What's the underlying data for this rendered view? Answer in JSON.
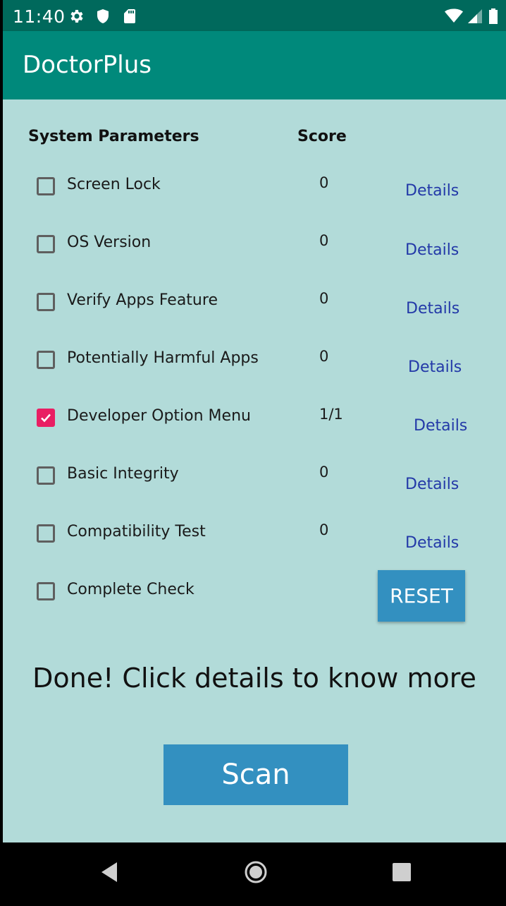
{
  "status_bar": {
    "time": "11:40",
    "icons": [
      "gear-icon",
      "shield-icon",
      "sd-card-icon",
      "wifi-icon",
      "signal-icon",
      "battery-icon"
    ]
  },
  "app_bar": {
    "title": "DoctorPlus",
    "color": "#00897b"
  },
  "table": {
    "header_param": "System Parameters",
    "header_score": "Score",
    "rows": [
      {
        "label": "Screen Lock",
        "checked": false,
        "score": "0",
        "details": "Details"
      },
      {
        "label": "OS Version",
        "checked": false,
        "score": "0",
        "details": "Details"
      },
      {
        "label": "Verify Apps Feature",
        "checked": false,
        "score": "0",
        "details": "Details"
      },
      {
        "label": "Potentially Harmful Apps",
        "checked": false,
        "score": "0",
        "details": "Details"
      },
      {
        "label": "Developer Option Menu",
        "checked": true,
        "score": "1/1",
        "details": "Details"
      },
      {
        "label": "Basic Integrity",
        "checked": false,
        "score": "0",
        "details": "Details"
      },
      {
        "label": "Compatibility Test",
        "checked": false,
        "score": "0",
        "details": "Details"
      }
    ],
    "complete_check": {
      "label": "Complete Check",
      "checked": false
    }
  },
  "reset_label": "RESET",
  "message": "Done! Click details to know more",
  "scan_label": "Scan",
  "colors": {
    "background": "#b2dbd9",
    "button": "#3390c0",
    "details_link": "#2339a8",
    "checkbox_checked": "#e91e63"
  },
  "nav_bar": {
    "icons": [
      "back-icon",
      "home-icon",
      "recents-icon"
    ]
  }
}
